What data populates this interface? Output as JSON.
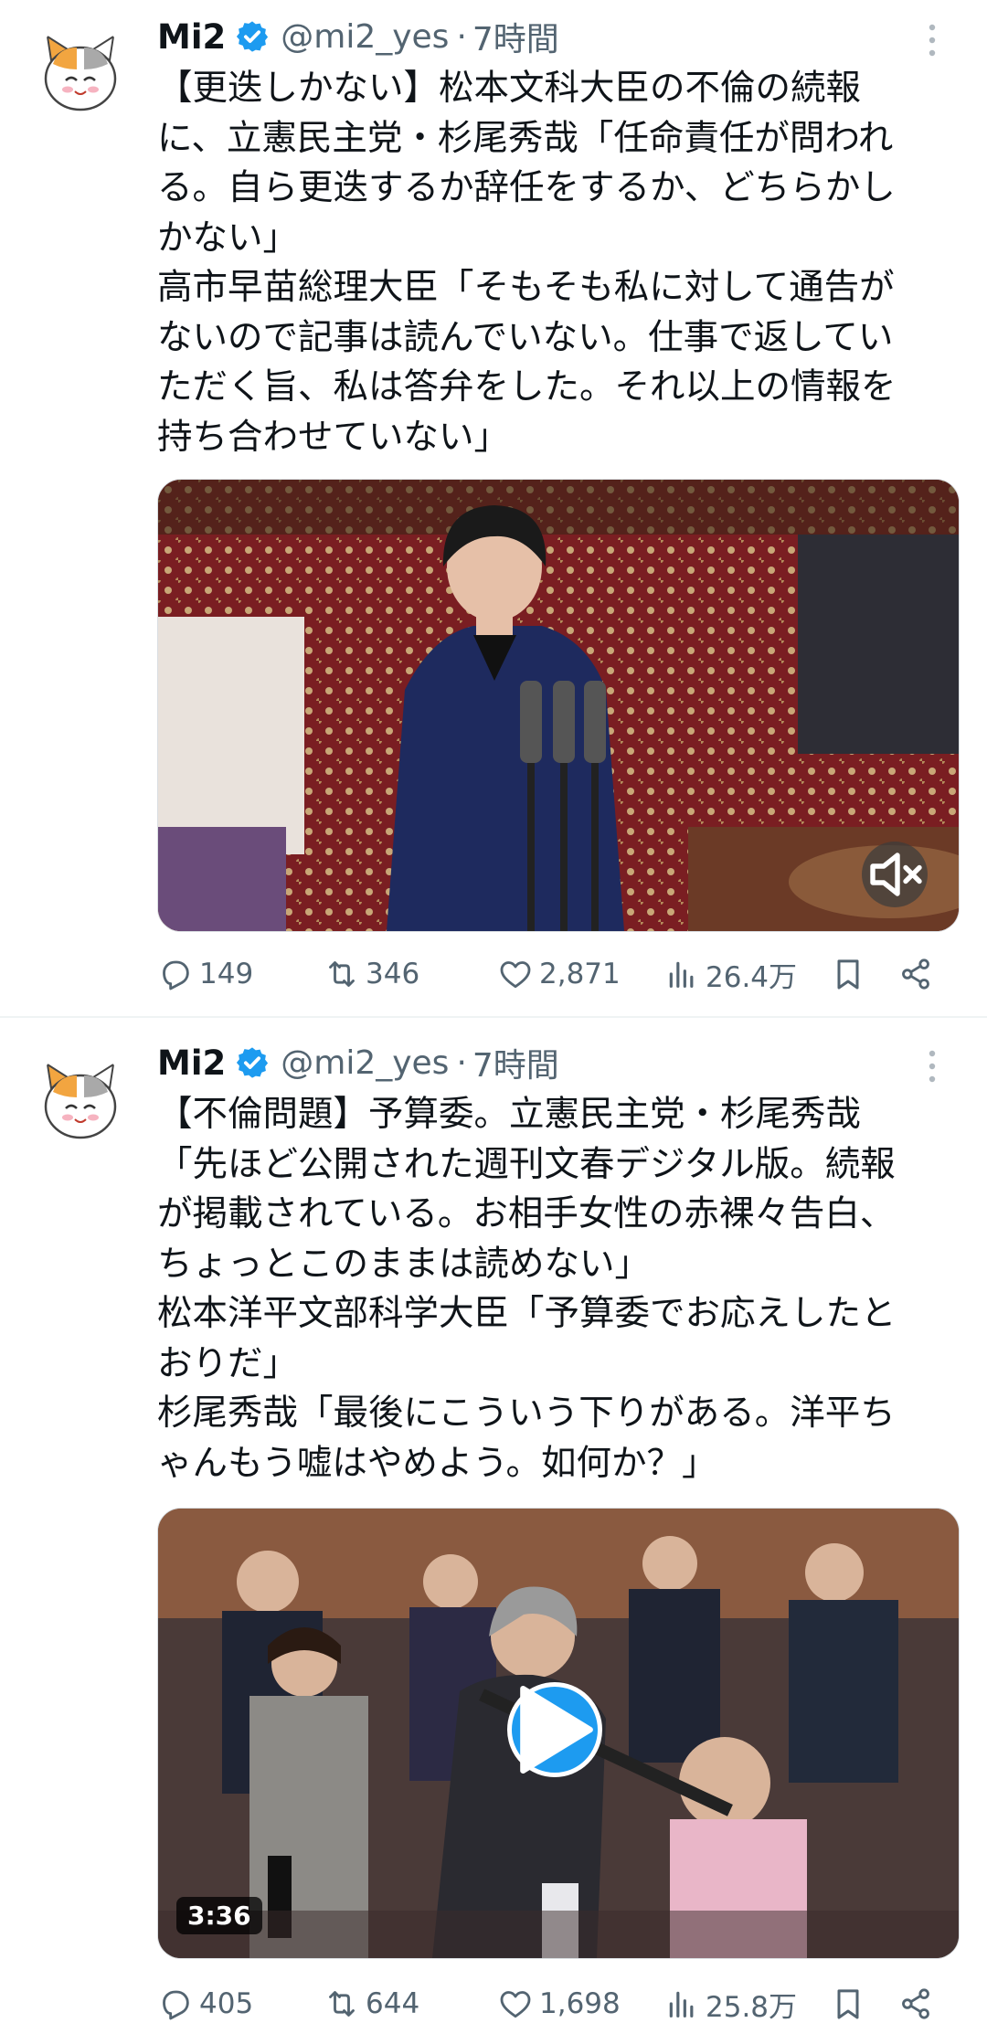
{
  "tweets": [
    {
      "author": {
        "name": "Mi2",
        "handle": "@mi2_yes",
        "time": "7時間",
        "separator": "·"
      },
      "text_lines": [
        "【更迭しかない】松本文科大臣の不倫の続報",
        "に、立憲民主党・杉尾秀哉「任命責任が問われ",
        "る。自ら更迭するか辞任をするか、どちらかし",
        "かない」",
        "高市早苗総理大臣「そもそも私に対して通告が",
        "ないので記事は読んでいない。仕事で返してい",
        "ただく旨、私は答弁をした。それ以上の情報を",
        "持ち合わせていない」"
      ],
      "media": {
        "kind": "video-muted",
        "icon": "mute-icon"
      },
      "stats": {
        "replies": "149",
        "retweets": "346",
        "likes": "2,871",
        "views": "26.4万"
      }
    },
    {
      "author": {
        "name": "Mi2",
        "handle": "@mi2_yes",
        "time": "7時間",
        "separator": "·"
      },
      "text_lines": [
        "【不倫問題】予算委。立憲民主党・杉尾秀哉",
        "「先ほど公開された週刊文春デジタル版。続報",
        "が掲載されている。お相手女性の赤裸々告白、",
        "ちょっとこのままは読めない」",
        "松本洋平文部科学大臣「予算委でお応えしたと",
        "おりだ」",
        "杉尾秀哉「最後にこういう下りがある。洋平ち",
        "ゃんもう嘘はやめよう。如何か？」"
      ],
      "media": {
        "kind": "video",
        "duration": "3:36",
        "icon": "play-icon"
      },
      "stats": {
        "replies": "405",
        "retweets": "644",
        "likes": "1,698",
        "views": "25.8万"
      }
    }
  ],
  "colors": {
    "accent": "#1d9bf0",
    "secondary_text": "#536471",
    "text": "#0f1419"
  }
}
